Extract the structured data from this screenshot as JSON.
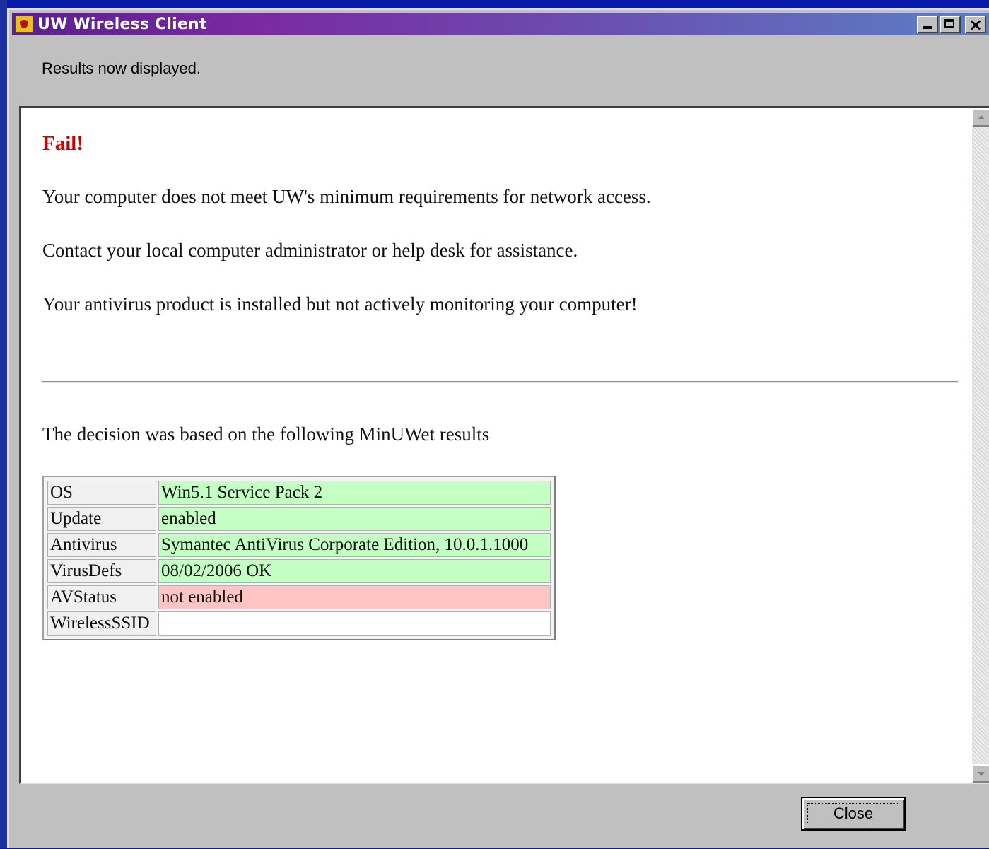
{
  "window": {
    "title": "UW Wireless Client"
  },
  "status": {
    "text": "Results now displayed."
  },
  "report": {
    "heading": "Fail!",
    "line1": "Your computer does not meet UW's minimum requirements for network access.",
    "line2": "Contact your local computer administrator or help desk for assistance.",
    "line3": "Your antivirus product is installed but not actively monitoring your computer!",
    "decision": "The decision was based on the following MinUWet results"
  },
  "results": [
    {
      "label": "OS",
      "value": "Win5.1 Service Pack 2",
      "status": "ok"
    },
    {
      "label": "Update",
      "value": "enabled",
      "status": "ok"
    },
    {
      "label": "Antivirus",
      "value": "Symantec AntiVirus Corporate Edition, 10.0.1.1000",
      "status": "ok"
    },
    {
      "label": "VirusDefs",
      "value": "08/02/2006 OK",
      "status": "ok"
    },
    {
      "label": "AVStatus",
      "value": "not enabled",
      "status": "bad"
    },
    {
      "label": "WirelessSSID",
      "value": "",
      "status": "empty"
    }
  ],
  "footer": {
    "close_label": "Close"
  },
  "colors": {
    "fail": "#cc0000",
    "ok_cell": "#c4ffc4",
    "bad_cell": "#ffc4c4"
  },
  "icons": {
    "app": "shield-icon",
    "minimize": "minimize-icon",
    "maximize": "maximize-icon",
    "close": "close-icon"
  }
}
